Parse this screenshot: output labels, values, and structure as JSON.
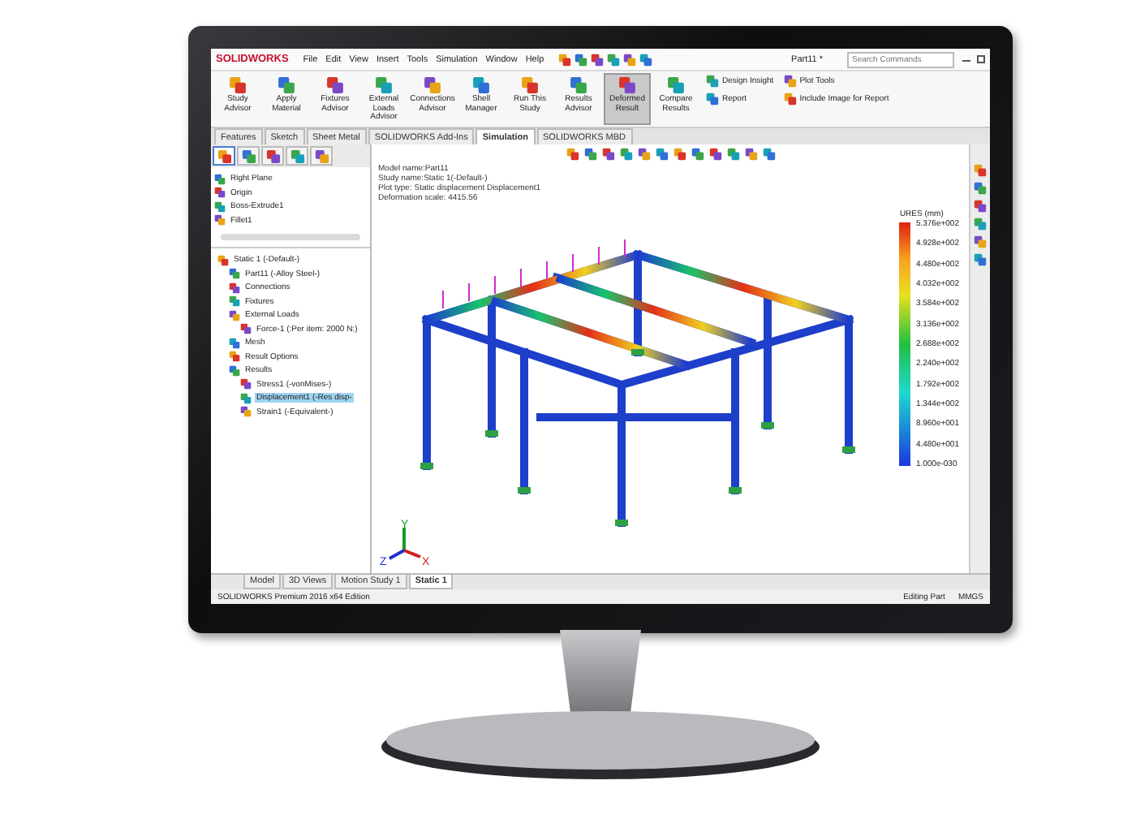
{
  "title_bar": {
    "logo": "SOLIDWORKS",
    "menu": [
      "File",
      "Edit",
      "View",
      "Insert",
      "Tools",
      "Simulation",
      "Window",
      "Help"
    ],
    "document": "Part11 *",
    "search": {
      "placeholder": "Search Commands"
    }
  },
  "ribbon": {
    "buttons": [
      {
        "label": "Study Advisor",
        "selected": false
      },
      {
        "label": "Apply Material",
        "selected": false
      },
      {
        "label": "Fixtures Advisor",
        "selected": false
      },
      {
        "label": "External Loads Advisor",
        "selected": false
      },
      {
        "label": "Connections Advisor",
        "selected": false
      },
      {
        "label": "Shell Manager",
        "selected": false
      },
      {
        "label": "Run This Study",
        "selected": false
      },
      {
        "label": "Results Advisor",
        "selected": false
      },
      {
        "label": "Deformed Result",
        "selected": true
      },
      {
        "label": "Compare Results",
        "selected": false
      }
    ],
    "small_buttons": [
      "Design Insight",
      "Plot Tools",
      "Report",
      "Include Image for Report"
    ]
  },
  "tabs": [
    {
      "label": "Features",
      "selected": false
    },
    {
      "label": "Sketch",
      "selected": false
    },
    {
      "label": "Sheet Metal",
      "selected": false
    },
    {
      "label": "SOLIDWORKS Add-Ins",
      "selected": false
    },
    {
      "label": "Simulation",
      "selected": true
    },
    {
      "label": "SOLIDWORKS MBD",
      "selected": false
    }
  ],
  "panel_tabs": [
    {
      "selected": true
    },
    {
      "selected": false
    },
    {
      "selected": false
    },
    {
      "selected": false
    },
    {
      "selected": false
    }
  ],
  "feature_tree": [
    "Right Plane",
    "Origin",
    "Boss-Extrude1",
    "Fillet1"
  ],
  "study_tree": [
    {
      "label": "Static 1 (-Default-)",
      "selected": false,
      "children": [
        {
          "label": "Part11 (-Alloy Steel-)",
          "selected": false
        },
        {
          "label": "Connections",
          "selected": false
        },
        {
          "label": "Fixtures",
          "selected": false
        },
        {
          "label": "External Loads",
          "selected": false,
          "children": [
            {
              "label": "Force-1 (:Per item: 2000 N:)",
              "selected": false
            }
          ]
        },
        {
          "label": "Mesh",
          "selected": false
        },
        {
          "label": "Result Options",
          "selected": false
        },
        {
          "label": "Results",
          "selected": false,
          "children": [
            {
              "label": "Stress1 (-vonMises-)",
              "selected": false
            },
            {
              "label": "Displacement1 (-Res disp-",
              "selected": true
            },
            {
              "label": "Strain1 (-Equivalent-)",
              "selected": false
            }
          ]
        }
      ]
    }
  ],
  "viewport": {
    "info": [
      "Model name:Part11",
      "Study name:Static 1(-Default-)",
      "Plot type: Static displacement Displacement1",
      "Deformation scale: 4415.56"
    ],
    "legend": {
      "title": "URES (mm)",
      "labels": [
        "5.376e+002",
        "4.928e+002",
        "4.480e+002",
        "4.032e+002",
        "3.584e+002",
        "3.136e+002",
        "2.688e+002",
        "2.240e+002",
        "1.792e+002",
        "1.344e+002",
        "8.960e+001",
        "4.480e+001",
        "1.000e-030"
      ]
    },
    "triad": [
      "Y",
      "Z",
      "X"
    ]
  },
  "bottom_tabs": [
    {
      "label": "Model",
      "selected": false
    },
    {
      "label": "3D Views",
      "selected": false
    },
    {
      "label": "Motion Study 1",
      "selected": false
    },
    {
      "label": "Static 1",
      "selected": true
    }
  ],
  "status_bar": {
    "text": "SOLIDWORKS Premium 2016 x64 Edition",
    "mode": "Editing Part",
    "units": "MMGS"
  }
}
